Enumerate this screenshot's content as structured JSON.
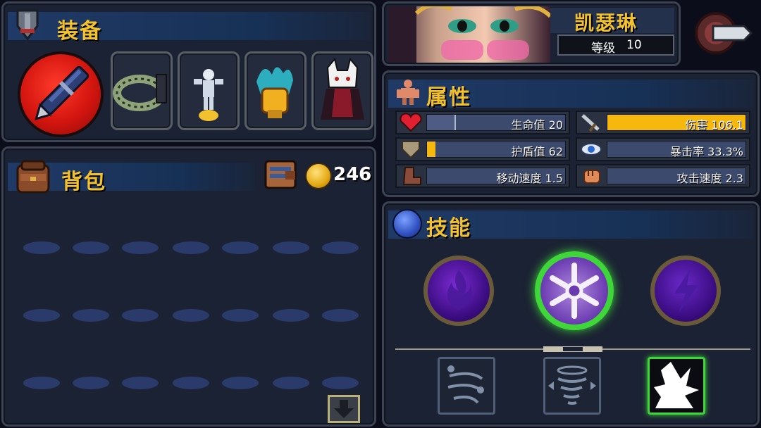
{
  "equipment": {
    "title": "装备"
  },
  "backpack": {
    "title": "背包",
    "gold": "246"
  },
  "hero": {
    "name": "凯瑟琳",
    "level_label": "等级",
    "level": "10"
  },
  "attributes": {
    "title": "属性",
    "stats": [
      {
        "label": "生命值 20",
        "fill": 0.2,
        "color": "#3c4a6e",
        "icon": "heart-icon"
      },
      {
        "label": "伤害 106.1",
        "fill": 1.0,
        "color": "#f7b80d",
        "icon": "sword-icon"
      },
      {
        "label": "护盾值 62",
        "fill": 0.06,
        "color": "#f7b80d",
        "icon": "shield-icon"
      },
      {
        "label": "暴击率 33.3%",
        "fill": 0.0,
        "color": "#3c4a6e",
        "icon": "eye-icon"
      },
      {
        "label": "移动速度 1.5",
        "fill": 0.0,
        "color": "#3c4a6e",
        "icon": "boot-icon"
      },
      {
        "label": "攻击速度 2.3",
        "fill": 0.0,
        "color": "#3c4a6e",
        "icon": "fist-icon"
      }
    ]
  },
  "skills": {
    "title": "技能"
  },
  "colors": {
    "accent": "#f2c12e",
    "panel": "#1b2233",
    "header_band": "#1f3a66",
    "slot_oval": "#2a3a6b"
  }
}
